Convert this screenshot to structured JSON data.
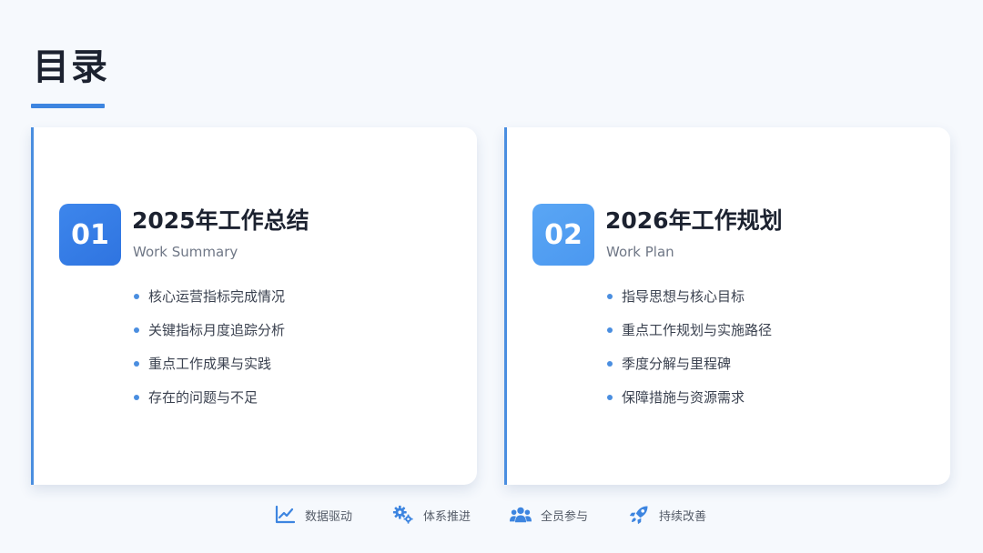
{
  "page": {
    "title": "目录"
  },
  "cards": [
    {
      "number": "01",
      "title": "2025年工作总结",
      "subtitle": "Work Summary",
      "items": [
        "核心运营指标完成情况",
        "关键指标月度追踪分析",
        "重点工作成果与实践",
        "存在的问题与不足"
      ]
    },
    {
      "number": "02",
      "title": "2026年工作规划",
      "subtitle": "Work Plan",
      "items": [
        "指导思想与核心目标",
        "重点工作规划与实施路径",
        "季度分解与里程碑",
        "保障措施与资源需求"
      ]
    }
  ],
  "footer": {
    "items": [
      {
        "icon": "line-chart-icon",
        "label": "数据驱动"
      },
      {
        "icon": "gears-icon",
        "label": "体系推进"
      },
      {
        "icon": "users-icon",
        "label": "全员参与"
      },
      {
        "icon": "rocket-icon",
        "label": "持续改善"
      }
    ]
  },
  "colors": {
    "accent": "#3d85e0",
    "badge_1": "#3580e8",
    "badge_2": "#52a0f2",
    "background": "#f6f9fd"
  }
}
